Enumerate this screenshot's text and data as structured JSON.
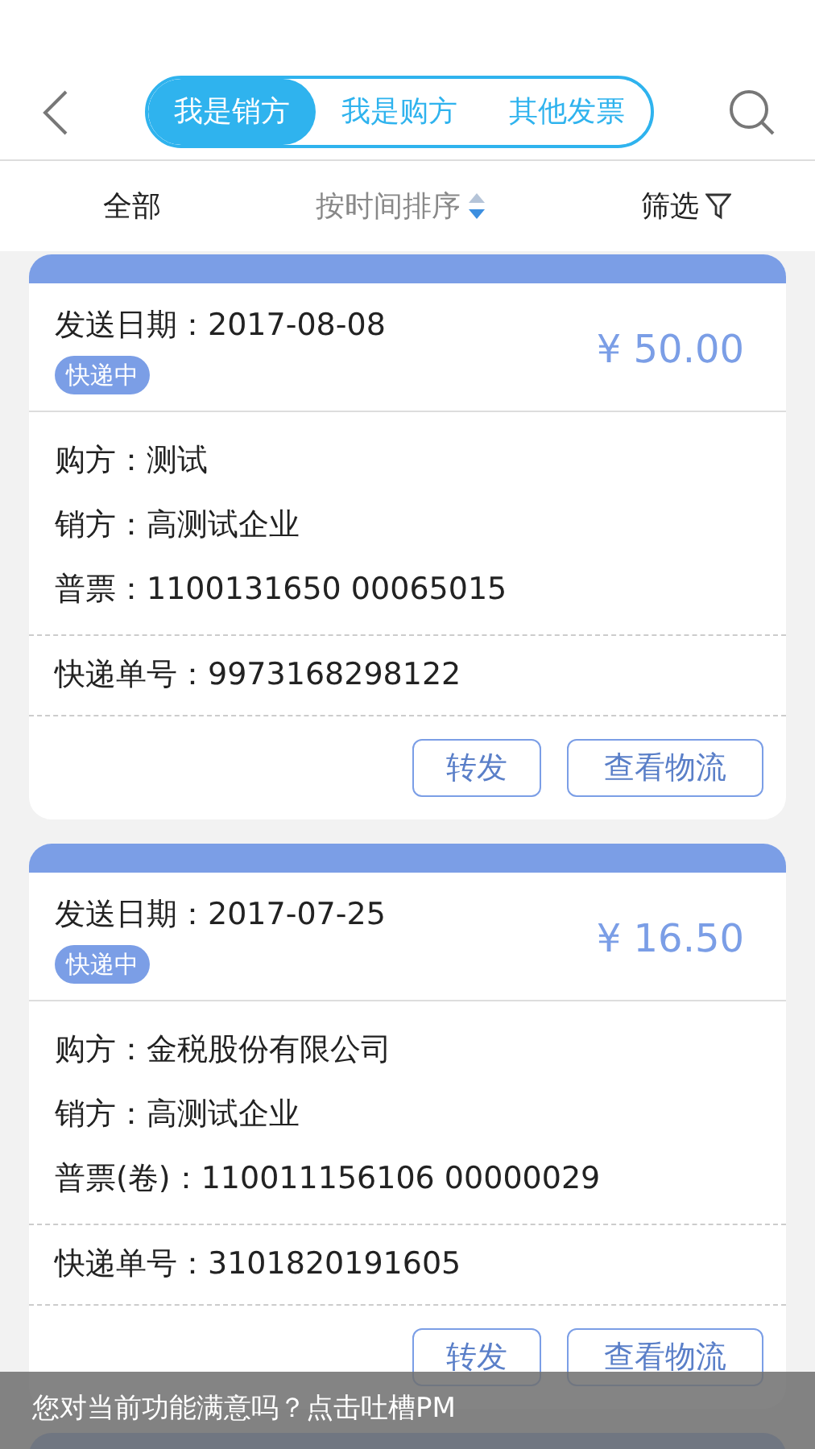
{
  "tabs": [
    {
      "label": "我是销方",
      "selected": true
    },
    {
      "label": "我是购方",
      "selected": false
    },
    {
      "label": "其他发票",
      "selected": false
    }
  ],
  "filters": [
    {
      "kind": "plain",
      "label": "全部"
    },
    {
      "kind": "sort",
      "label": "按时间排序"
    },
    {
      "kind": "filter",
      "label": "筛选"
    }
  ],
  "invoices": [
    {
      "date": "发送日期：2017-08-08",
      "status": "快递中",
      "amount": "¥ 50.00",
      "details": [
        "购方：测试",
        "销方：高测试企业",
        "普票：1100131650 00065015"
      ],
      "tracking": "快递单号：9973168298122",
      "buttons": [
        "转发",
        "查看物流"
      ]
    },
    {
      "date": "发送日期：2017-07-25",
      "status": "快递中",
      "amount": "¥ 16.50",
      "details": [
        "购方：金税股份有限公司",
        "销方：高测试企业",
        "普票(卷)：110011156106 00000029"
      ],
      "tracking": "快递单号：3101820191605",
      "buttons": [
        "转发",
        "查看物流"
      ]
    }
  ],
  "toast": "您对当前功能满意吗？点击吐槽PM"
}
